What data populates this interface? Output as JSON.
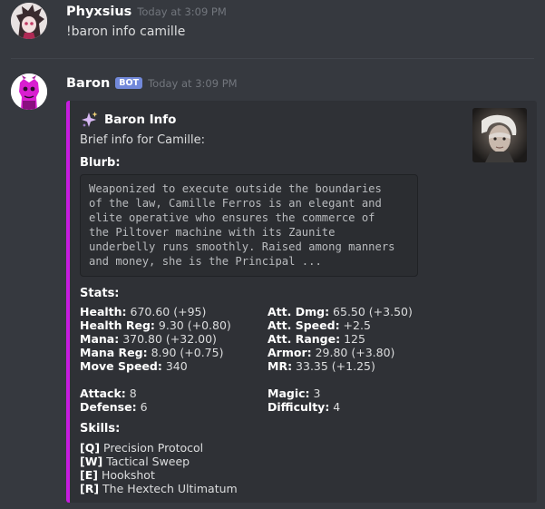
{
  "messages": [
    {
      "username": "Phyxsius",
      "timestamp": "Today at 3:09 PM",
      "text": "!baron info camille"
    },
    {
      "username": "Baron",
      "badge": "BOT",
      "timestamp": "Today at 3:09 PM",
      "embed": {
        "accent_color": "#c71cdf",
        "author_icon": "sparkles-icon",
        "author": "Baron Info",
        "description": "Brief info for Camille:",
        "thumbnail": "champion-portrait",
        "blurb_title": "Blurb:",
        "blurb_lines": [
          "Weaponized to execute outside the boundaries",
          "of the law, Camille Ferros is an elegant and",
          "elite operative who ensures the commerce of",
          "the Piltover machine with its Zaunite",
          "underbelly runs smoothly. Raised among manners",
          "and money, she is the Principal ..."
        ],
        "stats_title": "Stats:",
        "stats_left": [
          {
            "label": "Health:",
            "value": " 670.60 (+95)"
          },
          {
            "label": "Health Reg:",
            "value": " 9.30 (+0.80)"
          },
          {
            "label": "Mana:",
            "value": " 370.80 (+32.00)"
          },
          {
            "label": "Mana Reg:",
            "value": " 8.90 (+0.75)"
          },
          {
            "label": "Move Speed:",
            "value": " 340"
          }
        ],
        "stats_right": [
          {
            "label": "Att. Dmg:",
            "value": " 65.50 (+3.50)"
          },
          {
            "label": "Att. Speed:",
            "value": " +2.5"
          },
          {
            "label": "Att. Range:",
            "value": " 125"
          },
          {
            "label": "Armor:",
            "value": " 29.80 (+3.80)"
          },
          {
            "label": "MR:",
            "value": " 33.35 (+1.25)"
          }
        ],
        "ratings_left": [
          {
            "label": "Attack:",
            "value": " 8"
          },
          {
            "label": "Defense:",
            "value": " 6"
          }
        ],
        "ratings_right": [
          {
            "label": "Magic:",
            "value": " 3"
          },
          {
            "label": "Difficulty:",
            "value": " 4"
          }
        ],
        "skills_title": "Skills:",
        "skills": [
          {
            "key": "[Q]",
            "name": " Precision Protocol"
          },
          {
            "key": "[W]",
            "name": " Tactical Sweep"
          },
          {
            "key": "[E]",
            "name": " Hookshot"
          },
          {
            "key": "[R]",
            "name": " The Hextech Ultimatum"
          }
        ]
      }
    }
  ]
}
